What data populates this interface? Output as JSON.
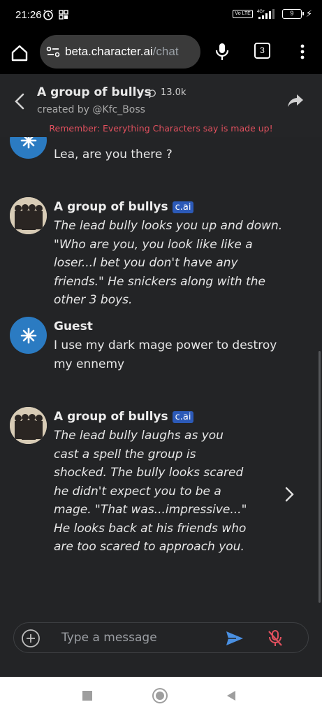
{
  "status_bar": {
    "time": "21:26",
    "network": "4G+",
    "volte": "Vo LTE",
    "battery": "9"
  },
  "browser": {
    "url_host": "beta.character.ai",
    "url_path": "/chat",
    "tab_count": "3"
  },
  "header": {
    "title": "A group of bullys",
    "chat_count": "13.0k",
    "creator": "created by @Kfc_Boss",
    "disclaimer": "Remember: Everything Characters say is made up!"
  },
  "messages": [
    {
      "sender": "",
      "badge": "",
      "text": "Lea, are you there ?"
    },
    {
      "sender": "A group of bullys",
      "badge": "c.ai",
      "text": "The lead bully looks you up and down. \"Who are you, you look like like a loser...I bet you don't have any friends.\" He snickers along with the other 3 boys."
    },
    {
      "sender": "Guest",
      "badge": "",
      "text": "I use my dark mage power to destroy my ennemy"
    },
    {
      "sender": "A group of bullys",
      "badge": "c.ai",
      "text": "The lead bully laughs as you cast a spell the group is shocked. The bully looks scared he didn't expect you to be a mage. \"That was...impressive...\" He looks back at his friends who are too scared to approach you."
    }
  ],
  "composer": {
    "placeholder": "Type a message"
  },
  "colors": {
    "background": "#232426",
    "disclaimer": "#e0505e",
    "badge": "#2c5ab8",
    "guest_avatar": "#2b7bc2",
    "send_icon": "#4a90e2",
    "mute_icon": "#e0505e"
  },
  "icons": [
    "alarm-icon",
    "grid-icon",
    "home-icon",
    "site-settings-icon",
    "mic-icon",
    "menu-icon",
    "back-icon",
    "chat-bubble-icon",
    "share-icon",
    "guest-star-icon",
    "next-icon",
    "add-icon",
    "send-icon",
    "mic-off-icon"
  ]
}
